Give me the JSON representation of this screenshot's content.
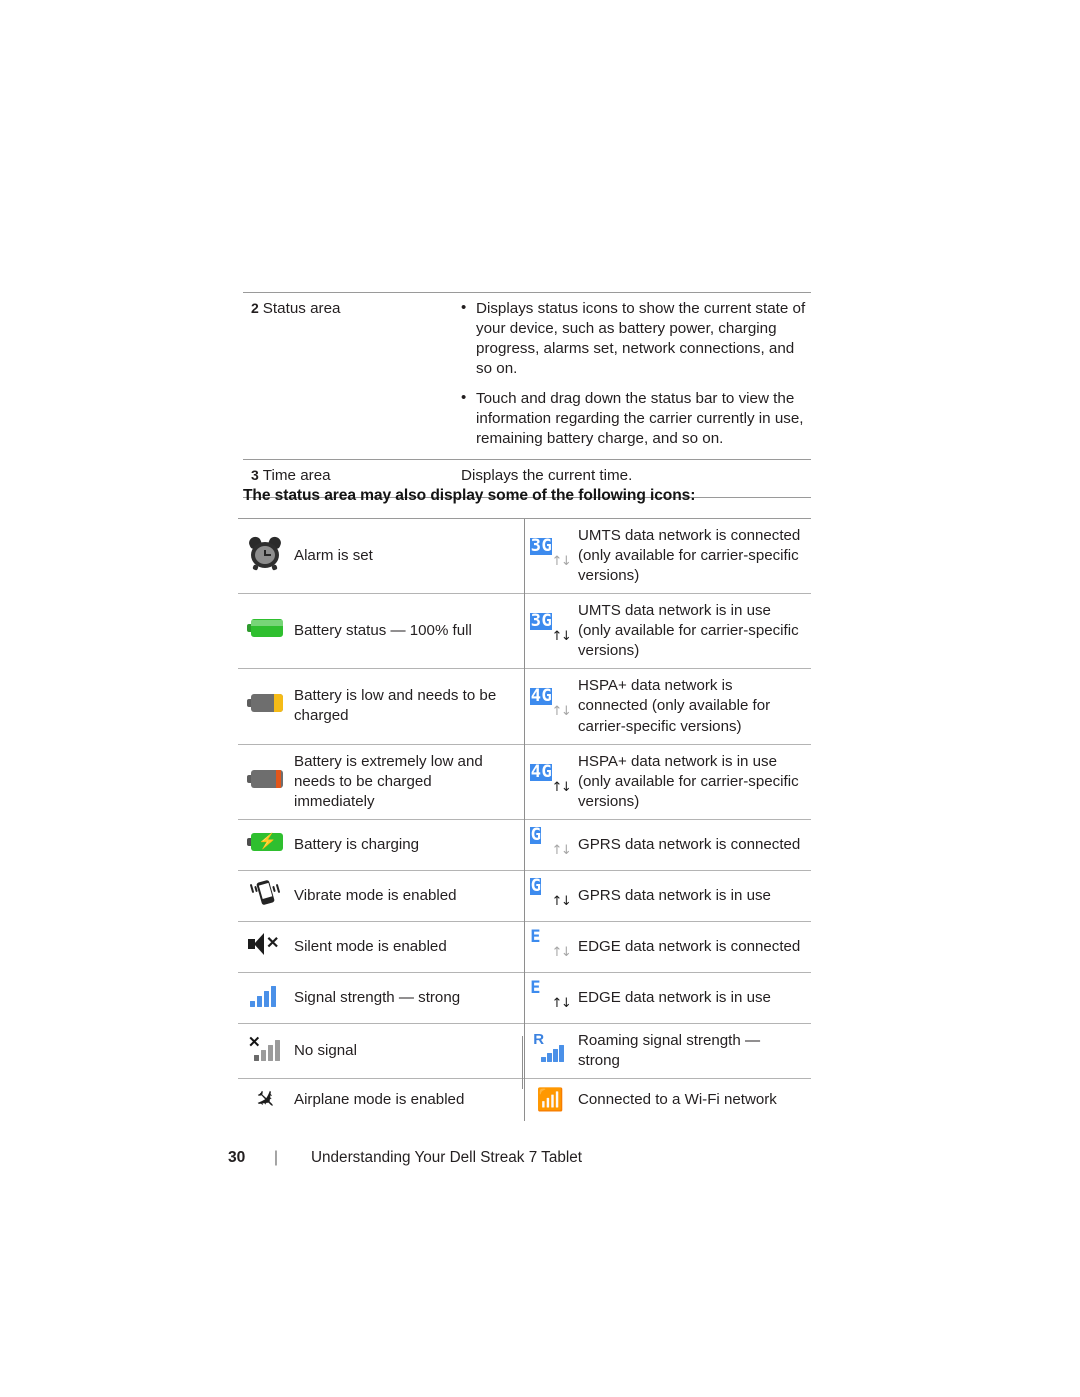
{
  "desc_table": {
    "rows": [
      {
        "index": "2",
        "label": "Status area",
        "bullets": [
          "Displays status icons to show the current state of your device, such as battery power, charging progress, alarms set, network connections, and so on.",
          "Touch and drag down the status bar to view the information regarding the carrier currently in use, remaining battery charge, and so on."
        ]
      },
      {
        "index": "3",
        "label": "Time area",
        "text": "Displays the current time."
      }
    ]
  },
  "icons_heading": "The status area may also display some of the following icons:",
  "icon_table": {
    "rows": [
      {
        "left": {
          "icon": "alarm-clock-icon",
          "text": "Alarm is set"
        },
        "right": {
          "icon": "umts-3g-connected-icon",
          "text": "UMTS data network is connected (only available for carrier-specific versions)"
        }
      },
      {
        "left": {
          "icon": "battery-full-icon",
          "text": "Battery status — 100% full"
        },
        "right": {
          "icon": "umts-3g-in-use-icon",
          "text": "UMTS data network is in use (only available for carrier-specific versions)"
        }
      },
      {
        "left": {
          "icon": "battery-low-icon",
          "text": "Battery is low and needs to be charged"
        },
        "right": {
          "icon": "hspa-4g-connected-icon",
          "text": "HSPA+ data network is connected (only available for carrier-specific versions)"
        }
      },
      {
        "left": {
          "icon": "battery-critical-icon",
          "text": "Battery is extremely low and needs to be charged immediately"
        },
        "right": {
          "icon": "hspa-4g-in-use-icon",
          "text": "HSPA+ data network is in use (only available for carrier-specific versions)"
        }
      },
      {
        "left": {
          "icon": "battery-charging-icon",
          "text": "Battery is charging"
        },
        "right": {
          "icon": "gprs-connected-icon",
          "text": "GPRS data network is connected"
        }
      },
      {
        "left": {
          "icon": "vibrate-mode-icon",
          "text": "Vibrate mode is enabled"
        },
        "right": {
          "icon": "gprs-in-use-icon",
          "text": "GPRS data network is in use"
        }
      },
      {
        "left": {
          "icon": "silent-mode-icon",
          "text": "Silent mode is enabled"
        },
        "right": {
          "icon": "edge-connected-icon",
          "text": "EDGE data network is connected"
        }
      },
      {
        "left": {
          "icon": "signal-strength-strong-icon",
          "text": "Signal strength — strong"
        },
        "right": {
          "icon": "edge-in-use-icon",
          "text": "EDGE data network is in use"
        }
      },
      {
        "left": {
          "icon": "no-signal-icon",
          "text": "No signal"
        },
        "right": {
          "icon": "roaming-signal-strong-icon",
          "text": "Roaming signal strength — strong"
        }
      },
      {
        "left": {
          "icon": "airplane-mode-icon",
          "text": "Airplane mode is enabled"
        },
        "right": {
          "icon": "wifi-connected-icon",
          "text": "Connected to a Wi-Fi network"
        }
      }
    ]
  },
  "footer": {
    "page_number": "30",
    "separator": "|",
    "title": "Understanding Your Dell Streak 7 Tablet"
  },
  "net_glyphs": {
    "umts": "3G",
    "hspa": "4G",
    "gprs": "G",
    "edge": "E",
    "arrows": "↑↓"
  }
}
